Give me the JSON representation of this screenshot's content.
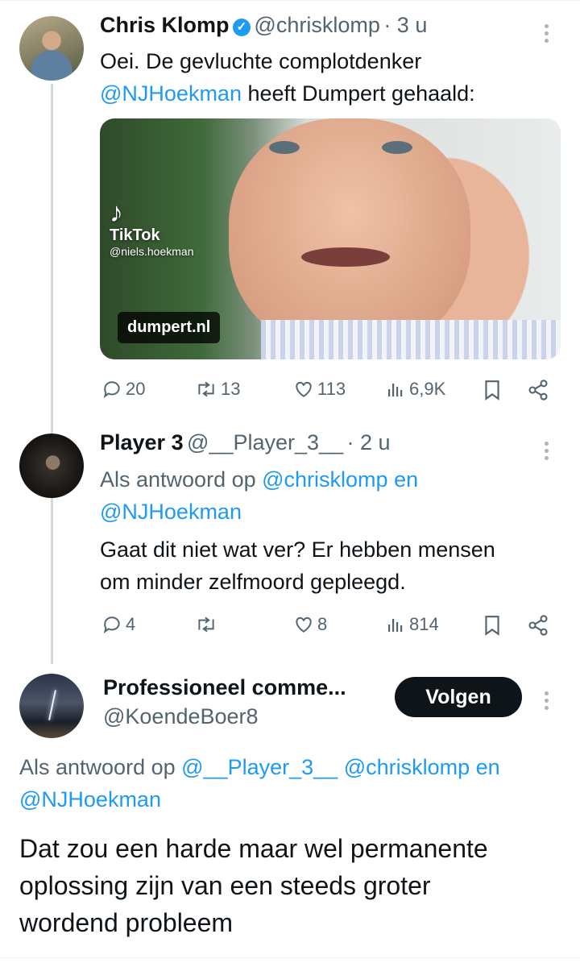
{
  "tweet1": {
    "name": "Chris Klomp",
    "handle": "@chrisklomp",
    "time": "· 3 u",
    "text_line1": "Oei. De gevluchte complotdenker",
    "mention": "@NJHoekman",
    "text_rest": " heeft Dumpert gehaald:",
    "media": {
      "tiktok_brand": "TikTok",
      "tiktok_user": "@niels.hoekman",
      "badge": "dumpert.nl"
    },
    "replies": "20",
    "retweets": "13",
    "likes": "113",
    "views": "6,9K"
  },
  "tweet2": {
    "name": "Player 3",
    "handle": "@__Player_3__",
    "time": "· 2 u",
    "reply_prefix": "Als antwoord op ",
    "reply_mention1": "@chrisklomp",
    "reply_conj": " en",
    "reply_mention2": "@NJHoekman",
    "text_line1": "Gaat dit niet wat ver? Er hebben mensen",
    "text_line2": "om minder zelfmoord gepleegd.",
    "replies": "4",
    "retweets": "",
    "likes": "8",
    "views": "814"
  },
  "tweet3": {
    "name": "Professioneel comme...",
    "handle": "@KoendeBoer8",
    "follow_label": "Volgen",
    "reply_prefix": "Als antwoord op ",
    "reply_mention1": "@__Player_3__",
    "reply_mention2": "@chrisklomp",
    "reply_conj": " en",
    "reply_mention3": "@NJHoekman",
    "text_line1": "Dat zou een harde maar wel permanente",
    "text_line2": "oplossing zijn van een steeds groter",
    "text_line3": "wordend probleem"
  },
  "icons": [
    "reply-icon",
    "retweet-icon",
    "like-icon",
    "views-icon",
    "bookmark-icon",
    "share-icon",
    "verified-icon",
    "more-icon"
  ],
  "colors": {
    "link": "#1d9bf0",
    "secondary": "#536471",
    "follow_bg": "#0f1419"
  }
}
